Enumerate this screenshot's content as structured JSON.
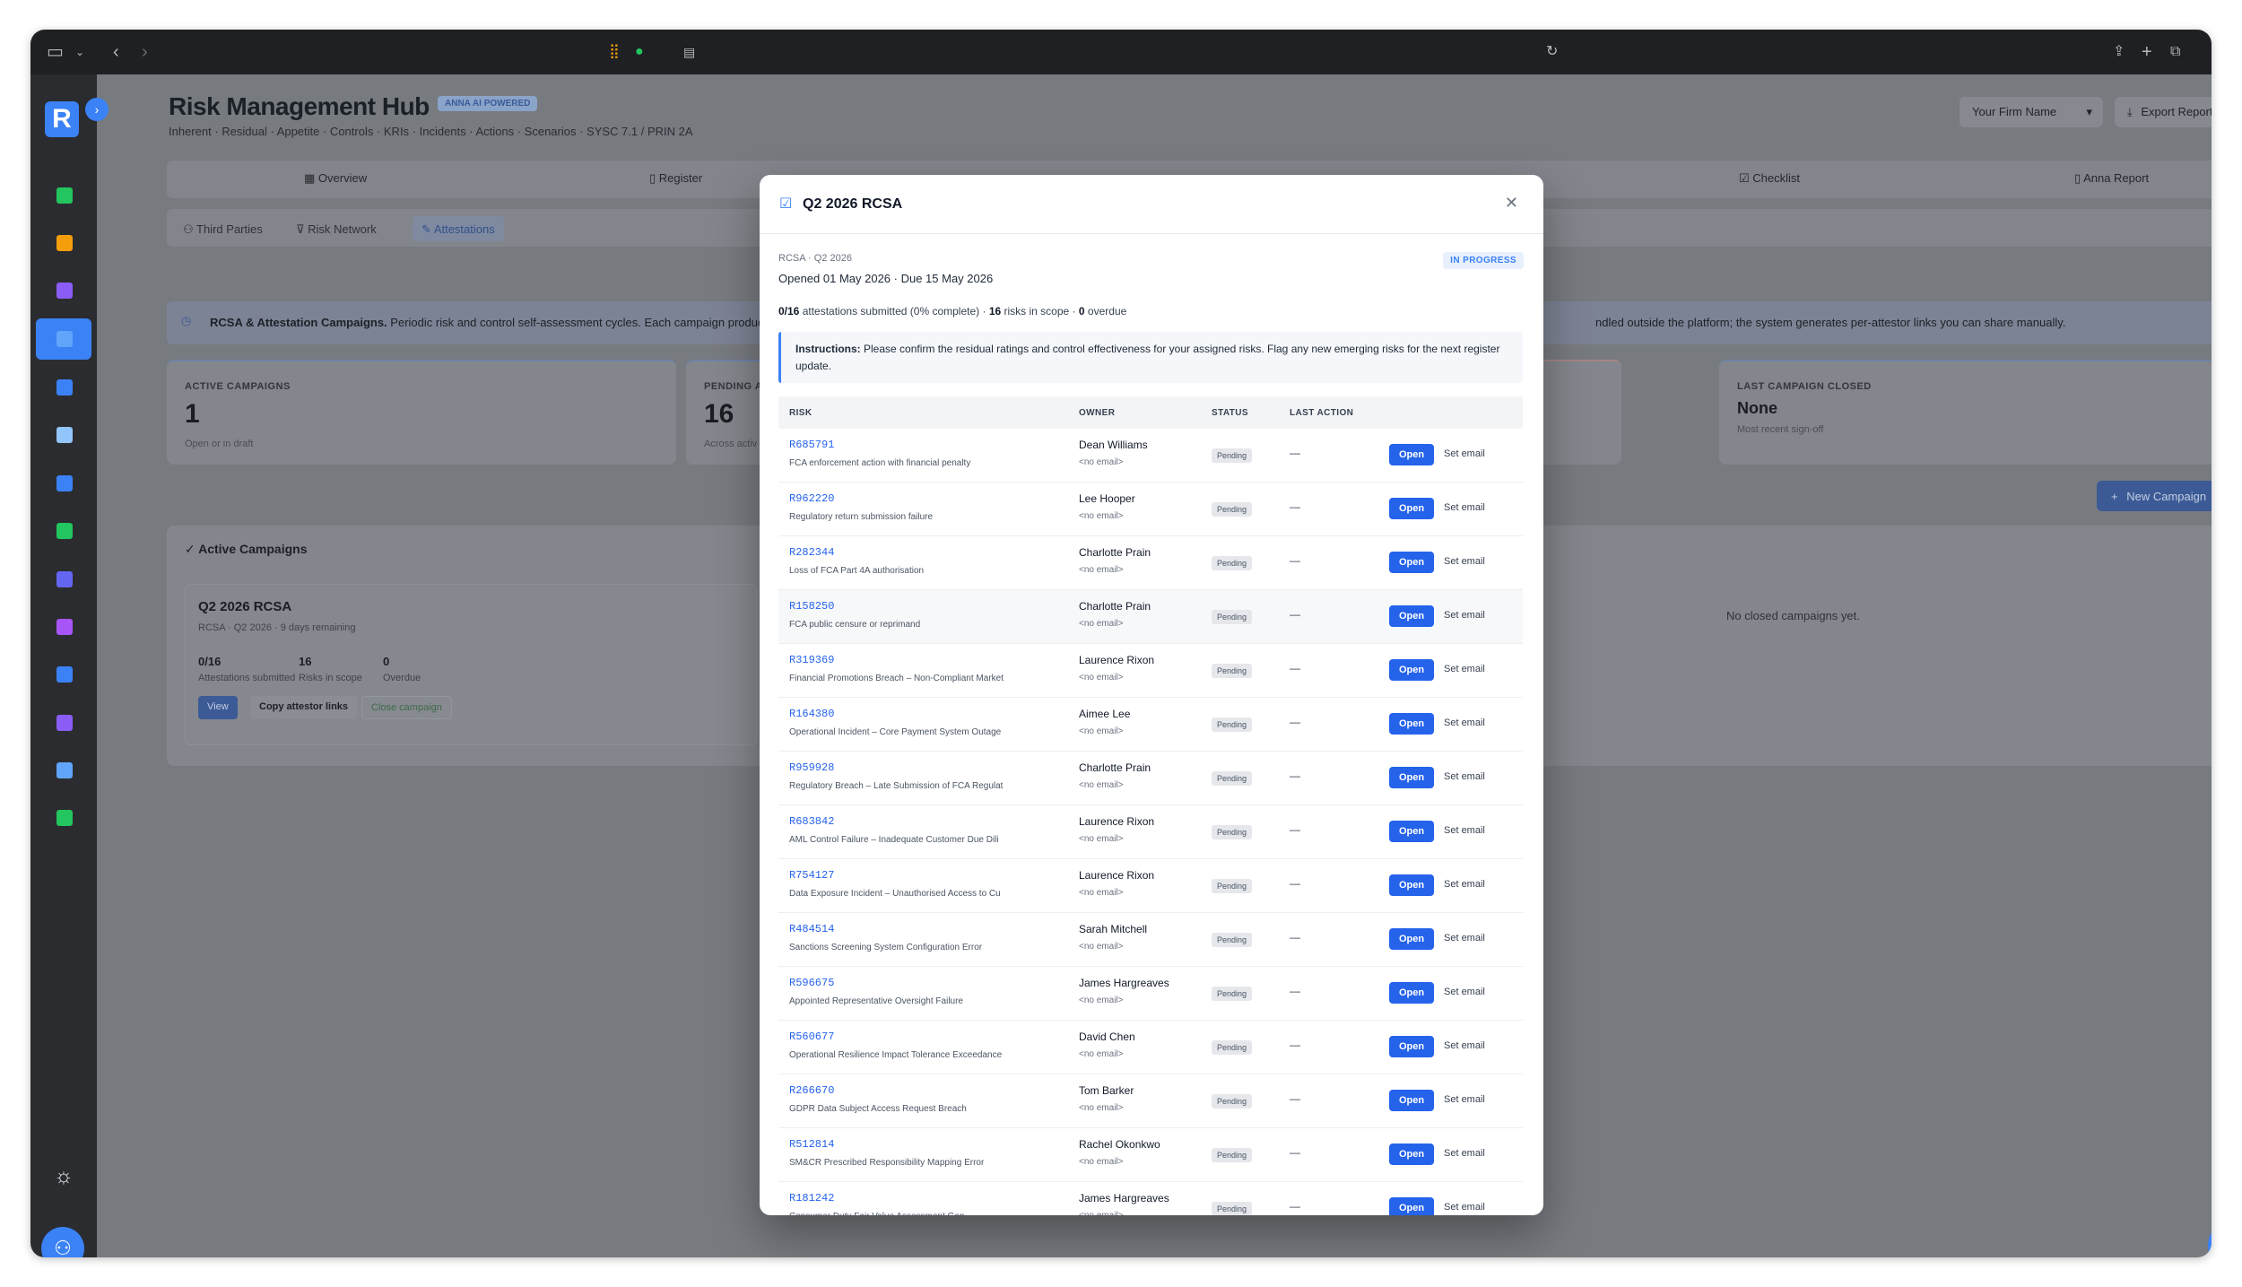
{
  "app": {
    "title": "Risk Management Hub",
    "ai_badge": "ANNA AI POWERED",
    "subtitle": "Inherent · Residual · Appetite · Controls · KRIs · Incidents · Actions · Scenarios · SYSC 7.1 / PRIN 2A",
    "firm_select": "Your Firm Name",
    "export_label": "Export Report"
  },
  "tabs_primary": [
    {
      "label": "Overview",
      "icon": "grid-icon"
    },
    {
      "label": "Register",
      "icon": "document-icon"
    },
    {
      "label": "Checklist",
      "icon": "checkbox-icon"
    },
    {
      "label": "Anna Report",
      "icon": "report-icon"
    }
  ],
  "tabs_secondary": [
    {
      "label": "Third Parties",
      "icon": "people-icon"
    },
    {
      "label": "Risk Network",
      "icon": "filter-icon"
    },
    {
      "label": "Attestations",
      "icon": "edit-icon"
    }
  ],
  "info_banner": {
    "title": "RCSA & Attestation Campaigns.",
    "text_left": "Periodic risk and control self-assessment cycles. Each campaign produc",
    "text_right": "ndled outside the platform; the system generates per-attestor links you can share manually."
  },
  "kpis": [
    {
      "label": "ACTIVE CAMPAIGNS",
      "value": "1",
      "sub": "Open or in draft"
    },
    {
      "label": "PENDING AT",
      "value": "16",
      "sub": "Across activ"
    },
    {
      "label": "LAST CAMPAIGN CLOSED",
      "value": "None",
      "sub": "Most recent sign-off"
    }
  ],
  "new_campaign_label": "New Campaign",
  "active_campaigns": {
    "heading": "Active Campaigns",
    "card": {
      "name": "Q2 2026 RCSA",
      "meta": "RCSA · Q2 2026 · 9 days remaining",
      "stats": [
        {
          "value": "0/16",
          "label": "Attestations submitted"
        },
        {
          "value": "16",
          "label": "Risks in scope"
        },
        {
          "value": "0",
          "label": "Overdue"
        }
      ],
      "view_label": "View",
      "copy_label": "Copy attestor links",
      "close_label": "Close campaign"
    },
    "no_closed": "No closed campaigns yet."
  },
  "modal": {
    "title": "Q2 2026 RCSA",
    "crumb": "RCSA · Q2 2026",
    "dates": "Opened 01 May 2026 · Due 15 May 2026",
    "status": "IN PROGRESS",
    "summary": {
      "submitted": "0/16",
      "submitted_text": "attestations submitted (0% complete) ·",
      "risks": "16",
      "risks_text": "risks in scope ·",
      "overdue": "0",
      "overdue_text": "overdue"
    },
    "instructions_label": "Instructions:",
    "instructions_text": "Please confirm the residual ratings and control effectiveness for your assigned risks. Flag any new emerging risks for the next register update.",
    "columns": [
      "RISK",
      "OWNER",
      "STATUS",
      "LAST ACTION"
    ],
    "open_label": "Open",
    "set_email_label": "Set email",
    "rows": [
      {
        "id": "R685791",
        "name": "FCA enforcement action with financial penalty",
        "owner": "Dean Williams",
        "email": "<no email>",
        "status": "Pending",
        "last": "—"
      },
      {
        "id": "R962220",
        "name": "Regulatory return submission failure",
        "owner": "Lee Hooper",
        "email": "<no email>",
        "status": "Pending",
        "last": "—"
      },
      {
        "id": "R282344",
        "name": "Loss of FCA Part 4A authorisation",
        "owner": "Charlotte Prain",
        "email": "<no email>",
        "status": "Pending",
        "last": "—"
      },
      {
        "id": "R158250",
        "name": "FCA public censure or reprimand",
        "owner": "Charlotte Prain",
        "email": "<no email>",
        "status": "Pending",
        "last": "—"
      },
      {
        "id": "R319369",
        "name": "Financial Promotions Breach – Non-Compliant Market",
        "owner": "Laurence Rixon",
        "email": "<no email>",
        "status": "Pending",
        "last": "—"
      },
      {
        "id": "R164380",
        "name": "Operational Incident – Core Payment System Outage",
        "owner": "Aimee Lee",
        "email": "<no email>",
        "status": "Pending",
        "last": "—"
      },
      {
        "id": "R959928",
        "name": "Regulatory Breach – Late Submission of FCA Regulat",
        "owner": "Charlotte Prain",
        "email": "<no email>",
        "status": "Pending",
        "last": "—"
      },
      {
        "id": "R683842",
        "name": "AML Control Failure – Inadequate Customer Due Dili",
        "owner": "Laurence Rixon",
        "email": "<no email>",
        "status": "Pending",
        "last": "—"
      },
      {
        "id": "R754127",
        "name": "Data Exposure Incident – Unauthorised Access to Cu",
        "owner": "Laurence Rixon",
        "email": "<no email>",
        "status": "Pending",
        "last": "—"
      },
      {
        "id": "R484514",
        "name": "Sanctions Screening System Configuration Error",
        "owner": "Sarah Mitchell",
        "email": "<no email>",
        "status": "Pending",
        "last": "—"
      },
      {
        "id": "R596675",
        "name": "Appointed Representative Oversight Failure",
        "owner": "James Hargreaves",
        "email": "<no email>",
        "status": "Pending",
        "last": "—"
      },
      {
        "id": "R560677",
        "name": "Operational Resilience Impact Tolerance Exceedance",
        "owner": "David Chen",
        "email": "<no email>",
        "status": "Pending",
        "last": "—"
      },
      {
        "id": "R266670",
        "name": "GDPR Data Subject Access Request Breach",
        "owner": "Tom Barker",
        "email": "<no email>",
        "status": "Pending",
        "last": "—"
      },
      {
        "id": "R512814",
        "name": "SM&CR Prescribed Responsibility Mapping Error",
        "owner": "Rachel Okonkwo",
        "email": "<no email>",
        "status": "Pending",
        "last": "—"
      },
      {
        "id": "R181242",
        "name": "Consumer Duty Fair Value Assessment Gap",
        "owner": "James Hargreaves",
        "email": "<no email>",
        "status": "Pending",
        "last": "—"
      }
    ]
  },
  "sidebar_icons": [
    {
      "name": "document-green-icon",
      "color": "#22c55e"
    },
    {
      "name": "building-icon",
      "color": "#f59e0b"
    },
    {
      "name": "users-icon",
      "color": "#8b5cf6"
    },
    {
      "name": "shield-check-icon",
      "color": "#60a5fa"
    },
    {
      "name": "chart-icon",
      "color": "#3b82f6"
    },
    {
      "name": "news-icon",
      "color": "#93c5fd"
    },
    {
      "name": "monitor-icon",
      "color": "#3b82f6"
    },
    {
      "name": "shield-green-icon",
      "color": "#22c55e"
    },
    {
      "name": "target-icon",
      "color": "#6366f1"
    },
    {
      "name": "store-icon",
      "color": "#a855f7"
    },
    {
      "name": "lock-shield-icon",
      "color": "#3b82f6"
    },
    {
      "name": "list-icon",
      "color": "#8b5cf6"
    },
    {
      "name": "report-chart-icon",
      "color": "#60a5fa"
    },
    {
      "name": "card-icon",
      "color": "#22c55e"
    }
  ]
}
